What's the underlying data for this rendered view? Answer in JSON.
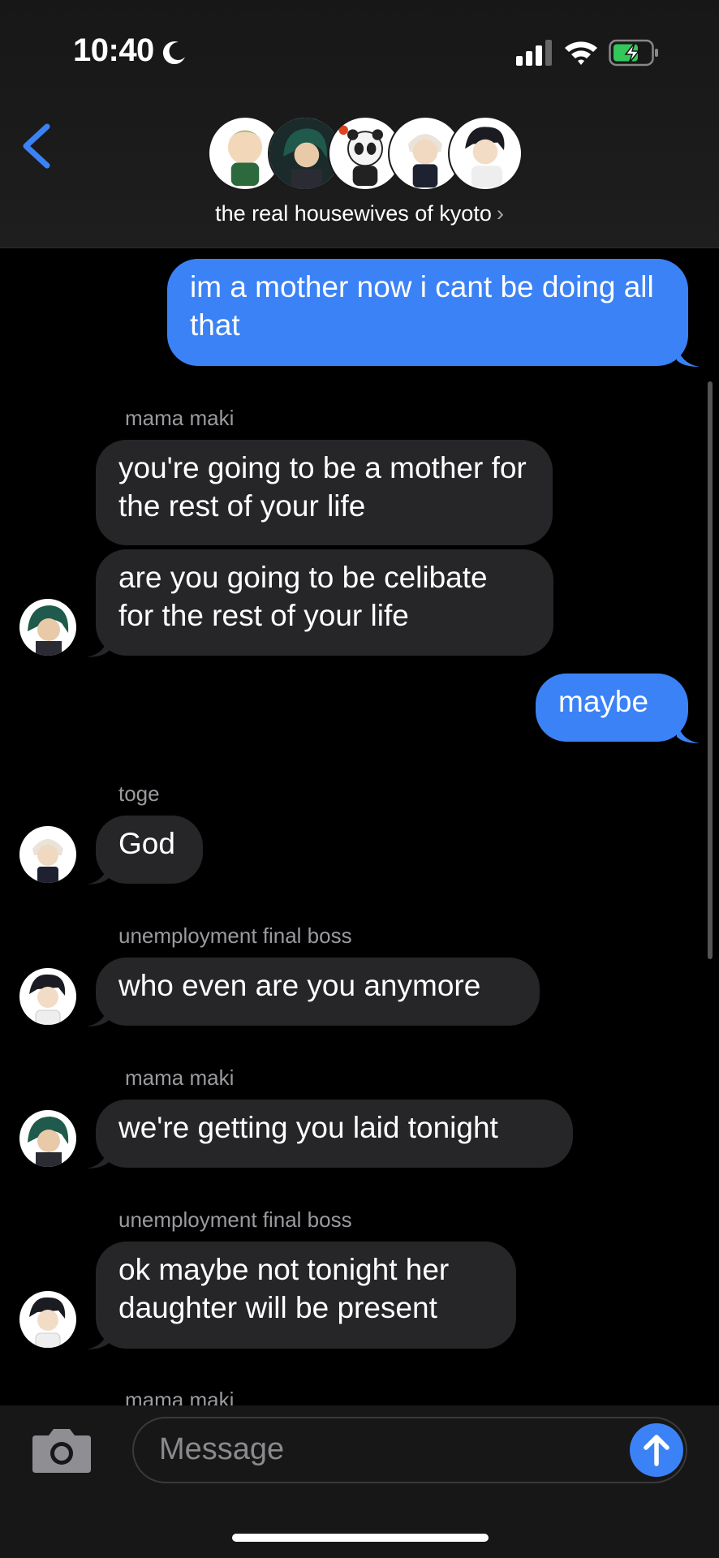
{
  "status_bar": {
    "time": "10:40"
  },
  "header": {
    "group_name": "the real housewives of kyoto",
    "chevron": "›"
  },
  "messages": [
    {
      "from": "me",
      "text": "im a mother now i cant be doing all that"
    },
    {
      "sender": "mama maki"
    },
    {
      "from": "mama maki",
      "text": "you're going to be a mother for the rest of your life"
    },
    {
      "from": "mama maki",
      "text": "are you going to be celibate for the rest of your life"
    },
    {
      "from": "me",
      "text": "maybe"
    },
    {
      "sender": "toge"
    },
    {
      "from": "toge",
      "text": "God"
    },
    {
      "sender": "unemployment final boss"
    },
    {
      "from": "unemployment final boss",
      "text": "who even are you anymore"
    },
    {
      "sender": "mama maki"
    },
    {
      "from": "mama maki",
      "text": "we're getting you laid tonight"
    },
    {
      "sender": "unemployment final boss"
    },
    {
      "from": "unemployment final boss",
      "text": "ok maybe not tonight her daughter will be present"
    },
    {
      "sender": "mama maki"
    }
  ],
  "input": {
    "placeholder": "Message"
  },
  "colors": {
    "outgoing_bubble": "#3b82f6",
    "incoming_bubble": "#262628",
    "accent": "#3b82f6"
  }
}
